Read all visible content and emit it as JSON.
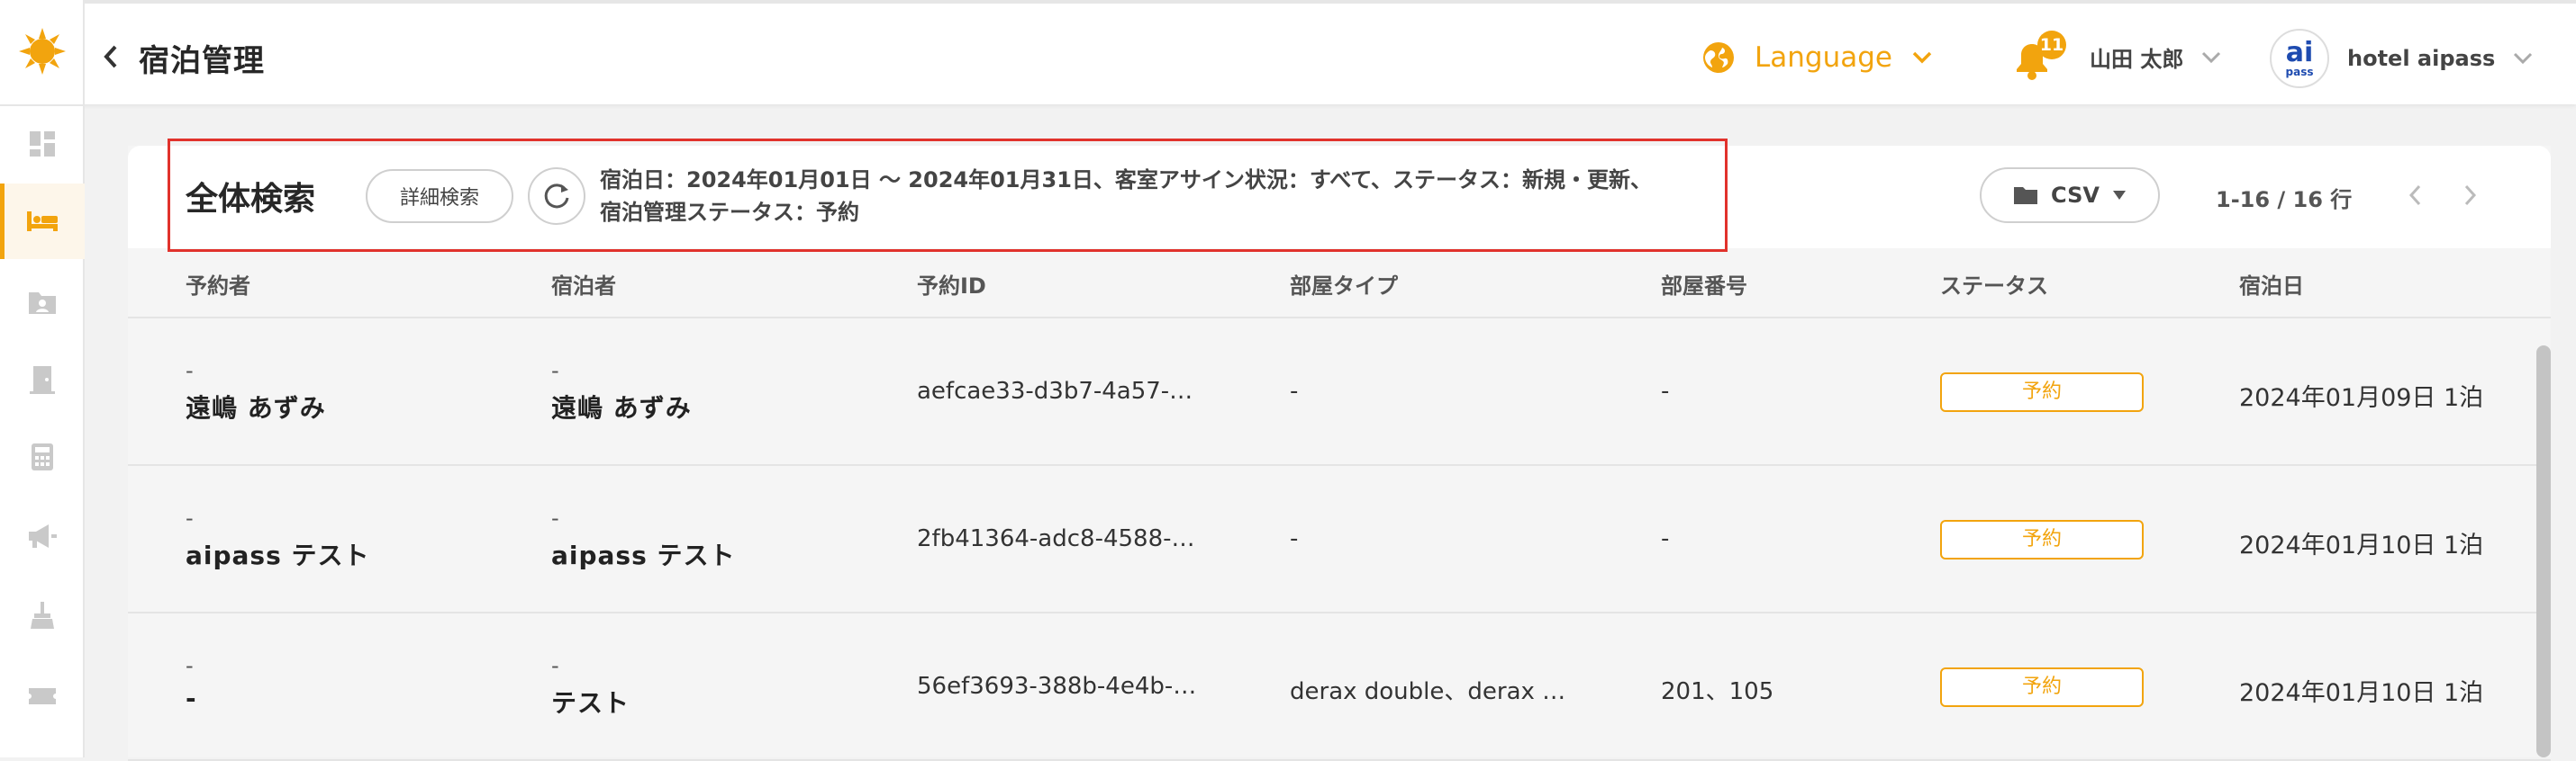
{
  "colors": {
    "accent": "#f2a40e",
    "highlight": "#e1322c",
    "brand_blue": "#1e4bb0"
  },
  "header": {
    "title": "宿泊管理",
    "language_label": "Language",
    "notification_count": "11",
    "user_name": "山田 太郎",
    "logo_ai": "ai",
    "logo_pass": "pass",
    "hotel_name": "hotel aipass"
  },
  "sidebar": {
    "items": [
      {
        "icon": "dashboard-icon",
        "active": false
      },
      {
        "icon": "bed-icon",
        "active": true
      },
      {
        "icon": "folder-user-icon",
        "active": false
      },
      {
        "icon": "door-icon",
        "active": false
      },
      {
        "icon": "calculator-icon",
        "active": false
      },
      {
        "icon": "megaphone-icon",
        "active": false
      },
      {
        "icon": "broom-icon",
        "active": false
      },
      {
        "icon": "ticket-icon",
        "active": false
      }
    ]
  },
  "toolbar": {
    "search_title": "全体検索",
    "detail_search_label": "詳細検索",
    "conditions_line1": "宿泊日：2024年01月01日 ～ 2024年01月31日、客室アサイン状況：すべて、ステータス：新規・更新、",
    "conditions_line2": "宿泊管理ステータス：予約",
    "csv_label": "CSV",
    "pager_text": "1-16 / 16 行"
  },
  "table": {
    "headers": [
      "予約者",
      "宿泊者",
      "予約ID",
      "部屋タイプ",
      "部屋番号",
      "ステータス",
      "宿泊日"
    ],
    "rows": [
      {
        "booker_kana": "-",
        "booker": "遠嶋 あずみ",
        "guest_kana": "-",
        "guest": "遠嶋 あずみ",
        "reservation_id": "aefcae33-d3b7-4a57-…",
        "room_type": "-",
        "room_number": "-",
        "status": "予約",
        "stay_date": "2024年01月09日 1泊"
      },
      {
        "booker_kana": "-",
        "booker": "aipass テスト",
        "guest_kana": "-",
        "guest": "aipass テスト",
        "reservation_id": "2fb41364-adc8-4588-…",
        "room_type": "-",
        "room_number": "-",
        "status": "予約",
        "stay_date": "2024年01月10日 1泊"
      },
      {
        "booker_kana": "-",
        "booker": "-",
        "guest_kana": "-",
        "guest": "テスト",
        "reservation_id": "56ef3693-388b-4e4b-…",
        "room_type": "derax double、derax …",
        "room_number": "201、105",
        "status": "予約",
        "stay_date": "2024年01月10日 1泊"
      }
    ]
  }
}
